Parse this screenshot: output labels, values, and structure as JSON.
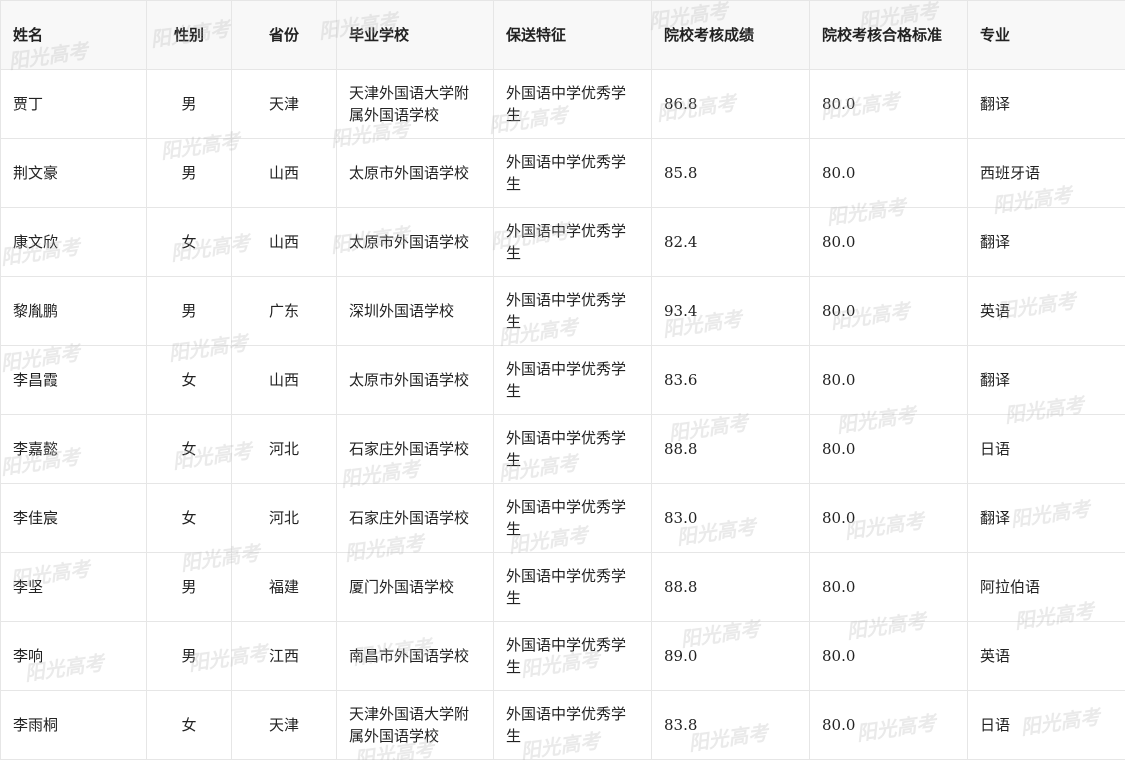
{
  "table": {
    "headers": [
      "姓名",
      "性别",
      "省份",
      "毕业学校",
      "保送特征",
      "院校考核成绩",
      "院校考核合格标准",
      "专业"
    ],
    "rows": [
      [
        "贾丁",
        "男",
        "天津",
        "天津外国语大学附属外国语学校",
        "外国语中学优秀学生",
        "86.8",
        "80.0",
        "翻译"
      ],
      [
        "荆文豪",
        "男",
        "山西",
        "太原市外国语学校",
        "外国语中学优秀学生",
        "85.8",
        "80.0",
        "西班牙语"
      ],
      [
        "康文欣",
        "女",
        "山西",
        "太原市外国语学校",
        "外国语中学优秀学生",
        "82.4",
        "80.0",
        "翻译"
      ],
      [
        "黎胤鹏",
        "男",
        "广东",
        "深圳外国语学校",
        "外国语中学优秀学生",
        "93.4",
        "80.0",
        "英语"
      ],
      [
        "李昌霞",
        "女",
        "山西",
        "太原市外国语学校",
        "外国语中学优秀学生",
        "83.6",
        "80.0",
        "翻译"
      ],
      [
        "李嘉懿",
        "女",
        "河北",
        "石家庄外国语学校",
        "外国语中学优秀学生",
        "88.8",
        "80.0",
        "日语"
      ],
      [
        "李佳宸",
        "女",
        "河北",
        "石家庄外国语学校",
        "外国语中学优秀学生",
        "83.0",
        "80.0",
        "翻译"
      ],
      [
        "李坚",
        "男",
        "福建",
        "厦门外国语学校",
        "外国语中学优秀学生",
        "88.8",
        "80.0",
        "阿拉伯语"
      ],
      [
        "李响",
        "男",
        "江西",
        "南昌市外国语学校",
        "外国语中学优秀学生",
        "89.0",
        "80.0",
        "英语"
      ],
      [
        "李雨桐",
        "女",
        "天津",
        "天津外国语大学附属外国语学校",
        "外国语中学优秀学生",
        "83.8",
        "80.0",
        "日语"
      ]
    ]
  },
  "watermark": {
    "text": "阳光高考"
  }
}
